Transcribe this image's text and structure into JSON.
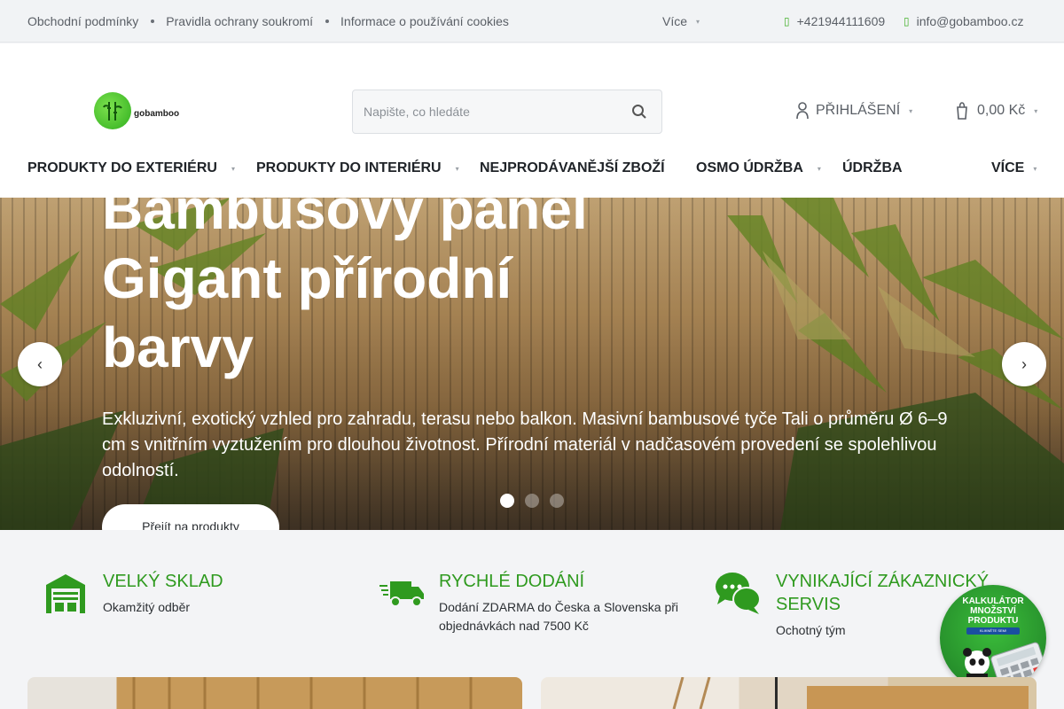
{
  "topbar": {
    "links": [
      "Obchodní podmínky",
      "Pravidla ochrany soukromí",
      "Informace o používání cookies"
    ],
    "more_label": "Více",
    "phone": "+421944111609",
    "email": "info@gobamboo.cz"
  },
  "header": {
    "logo_text": "gobamboo",
    "search_placeholder": "Napište, co hledáte",
    "login_label": "PŘIHLÁŠENÍ",
    "cart_total": "0,00 Kč"
  },
  "nav": {
    "items": [
      {
        "label": "PRODUKTY DO EXTERIÉRU",
        "has_submenu": true
      },
      {
        "label": "PRODUKTY DO INTERIÉRU",
        "has_submenu": true
      },
      {
        "label": "NEJPRODÁVANĚJŠÍ ZBOŽÍ",
        "has_submenu": false
      },
      {
        "label": "OSMO ÚDRŽBA",
        "has_submenu": true
      },
      {
        "label": "ÚDRŽBA",
        "has_submenu": false
      },
      {
        "label": "VÍCE",
        "has_submenu": true
      }
    ]
  },
  "hero": {
    "title": "Bambusový panel Gigant přírodní barvy",
    "description": "Exkluzivní, exotický vzhled pro zahradu, terasu nebo balkon. Masivní bambusové tyče Tali o průměru Ø 6–9 cm s vnitřním vyztužením pro dlouhou životnost. Přírodní materiál v nadčasovém provedení se spolehlivou odolností.",
    "cta_label": "Přejít na produkty",
    "slide_count": 3,
    "active_slide": 1
  },
  "features": [
    {
      "title": "VELKÝ SKLAD",
      "subtitle": "Okamžitý odběr",
      "icon": "warehouse-icon"
    },
    {
      "title": "RYCHLÉ DODÁNÍ",
      "subtitle": "Dodání ZDARMA do Česka a Slovenska při objednávkách nad 7500 Kč",
      "icon": "delivery-truck-icon"
    },
    {
      "title": "VYNIKAJÍCÍ ZÁKAZNICKÝ SERVIS",
      "subtitle": "Ochotný tým",
      "icon": "chat-bubbles-icon"
    }
  ],
  "badge": {
    "line1": "KALKULÁTOR",
    "line2": "MNOŽSTVÍ",
    "line3": "PRODUKTU",
    "button": "KLIKNĚTE SEM!"
  },
  "colors": {
    "accent_green": "#2f9a1f",
    "icon_green": "#43b02a",
    "topbar_bg": "#f1f3f5"
  }
}
